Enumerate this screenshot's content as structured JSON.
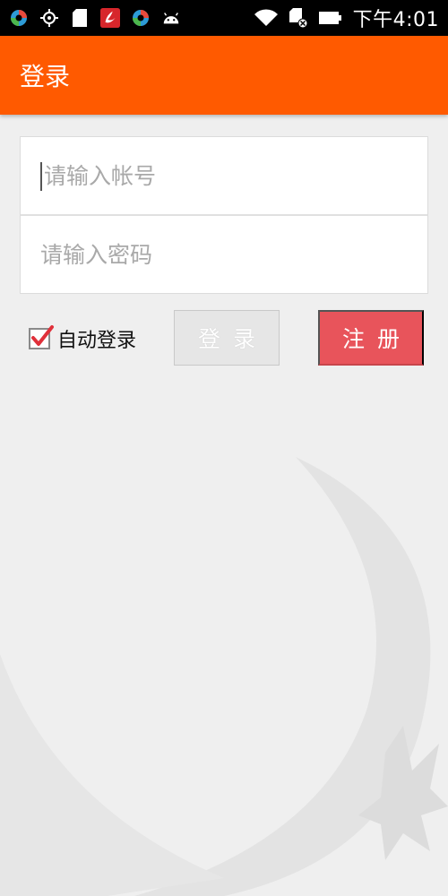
{
  "status_bar": {
    "time": "下午4:01",
    "icons": [
      "app-icon-1",
      "gps-icon",
      "sd-card-icon",
      "app-icon-2",
      "app-icon-3",
      "android-icon",
      "wifi-icon",
      "no-sim-icon",
      "battery-icon"
    ]
  },
  "app_bar": {
    "title": "登录"
  },
  "form": {
    "account_placeholder": "请输入帐号",
    "password_placeholder": "请输入密码",
    "account_value": "",
    "password_value": ""
  },
  "actions": {
    "auto_login_label": "自动登录",
    "auto_login_checked": true,
    "login_label": "登录",
    "register_label": "注册"
  },
  "colors": {
    "app_bar": "#ff5a00",
    "register_button": "#e8545b",
    "checkmark": "#e0303a",
    "background": "#efefef"
  }
}
